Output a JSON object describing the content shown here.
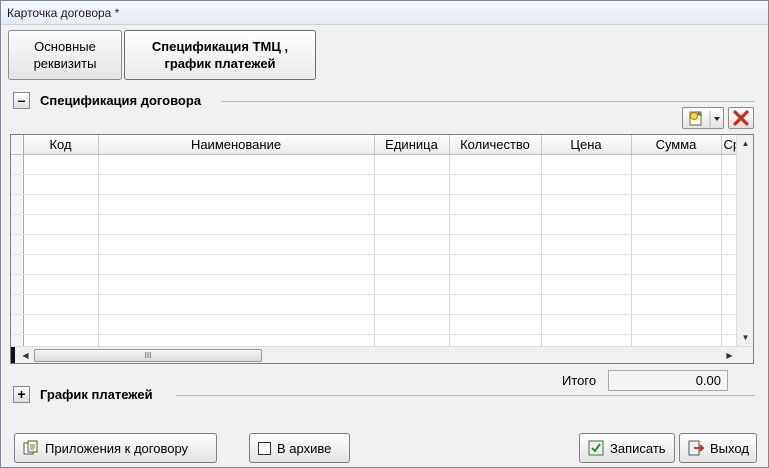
{
  "window": {
    "title": "Карточка договора *"
  },
  "tabs": [
    {
      "label_line1": "Основные",
      "label_line2": "реквизиты"
    },
    {
      "label_line1": "Спецификация ТМЦ ,",
      "label_line2": "график платежей"
    }
  ],
  "spec_section": {
    "toggle": "–",
    "title": "Спецификация договора"
  },
  "grid": {
    "columns": [
      "Код",
      "Наименование",
      "Единица",
      "Количество",
      "Цена",
      "Сумма",
      "Ср"
    ],
    "scroll_thumb_grip": "III"
  },
  "totals": {
    "label": "Итого",
    "value": "0.00"
  },
  "payments_section": {
    "toggle": "+",
    "title": "График платежей"
  },
  "buttons": {
    "attachments": "Приложения к договору",
    "archive": "В архиве",
    "save": "Записать",
    "exit": "Выход"
  },
  "colors": {
    "delete_red": "#d12a1a",
    "accent_green": "#2e8b3a"
  }
}
